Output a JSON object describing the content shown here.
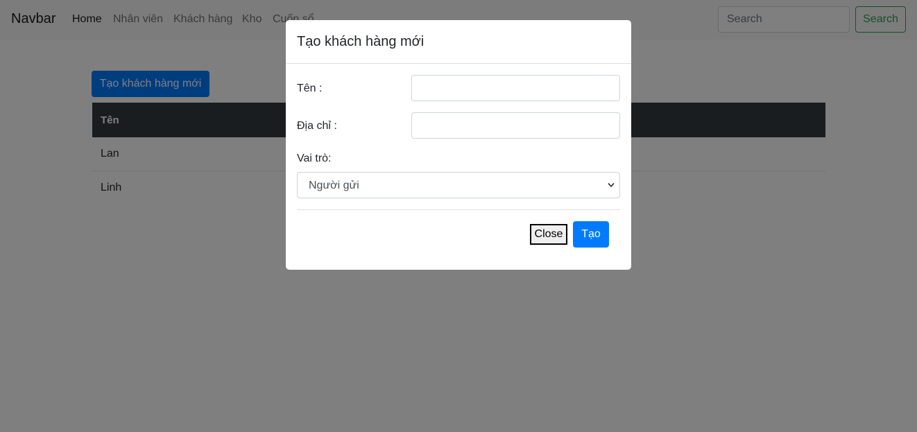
{
  "navbar": {
    "brand": "Navbar",
    "links": [
      {
        "label": "Home",
        "active": true
      },
      {
        "label": "Nhân viên",
        "active": false
      },
      {
        "label": "Khách hàng",
        "active": false
      },
      {
        "label": "Kho",
        "active": false
      },
      {
        "label": "Cuốn sổ",
        "active": false
      }
    ],
    "search_placeholder": "Search",
    "search_button": "Search"
  },
  "main": {
    "create_button": "Tạo khách hàng mới",
    "table": {
      "headers": [
        "Tên"
      ],
      "rows": [
        [
          "Lan"
        ],
        [
          "Linh"
        ]
      ]
    }
  },
  "modal": {
    "title": "Tạo khách hàng mới",
    "name_label": "Tên :",
    "name_value": "",
    "address_label": "Địa chỉ :",
    "address_value": "",
    "role_label": "Vai trò:",
    "role_selected": "Người gửi",
    "close_button": "Close",
    "submit_button": "Tạo"
  },
  "colors": {
    "primary": "#007bff",
    "success": "#28a745",
    "table_header": "#343a40",
    "backdrop": "#000000"
  }
}
